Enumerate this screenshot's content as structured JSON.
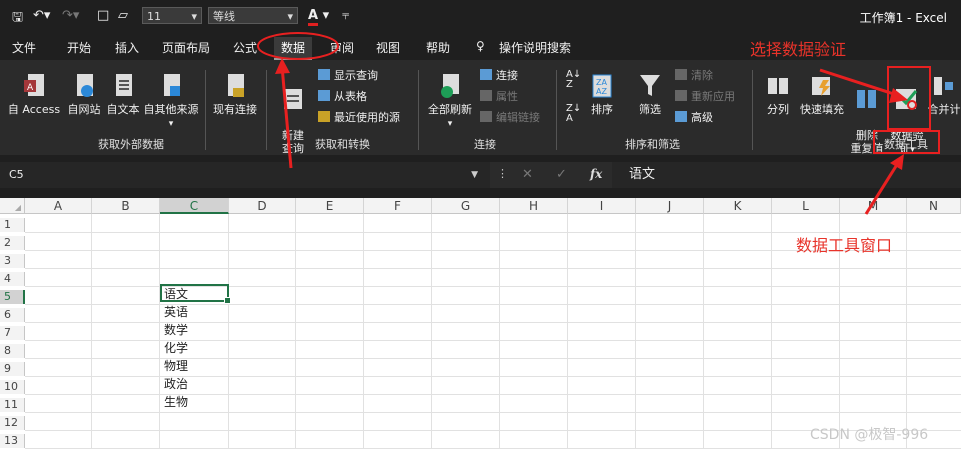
{
  "qat": {
    "font_size": "11",
    "font_name": "等线",
    "font_color_btn": "A",
    "title": "工作簿1 - Excel"
  },
  "menu": [
    {
      "label": "文件"
    },
    {
      "label": "开始"
    },
    {
      "label": "插入"
    },
    {
      "label": "页面布局"
    },
    {
      "label": "公式"
    },
    {
      "label": "数据"
    },
    {
      "label": "审阅"
    },
    {
      "label": "视图"
    },
    {
      "label": "帮助"
    },
    {
      "label": "操作说明搜索"
    }
  ],
  "ribbon": {
    "get_external": {
      "access": "自 Access",
      "web": "自网站",
      "text": "自文本",
      "other": "自其他来源",
      "existing": "现有连接",
      "group": "获取外部数据"
    },
    "transform": {
      "new_query": "新建\n查询",
      "show_queries": "显示查询",
      "from_table": "从表格",
      "recent_sources": "最近使用的源",
      "group": "获取和转换"
    },
    "connections": {
      "refresh_all": "全部刷新",
      "connections": "连接",
      "properties": "属性",
      "edit_links": "编辑链接",
      "group": "连接"
    },
    "sort_filter": {
      "sort": "排序",
      "filter": "筛选",
      "clear": "清除",
      "reapply": "重新应用",
      "advanced": "高级",
      "group": "排序和筛选"
    },
    "data_tools": {
      "text_to_columns": "分列",
      "flash_fill": "快速填充",
      "remove_dup": "删除\n重复值",
      "validation": "数据验\n证",
      "consolidate": "合并计",
      "group": "数据工具"
    }
  },
  "formula_bar": {
    "name_box": "C5",
    "fx": "fx",
    "value": "语文"
  },
  "grid": {
    "columns": [
      "A",
      "B",
      "C",
      "D",
      "E",
      "F",
      "G",
      "H",
      "I",
      "J",
      "K",
      "L",
      "M",
      "N"
    ],
    "rows": [
      "1",
      "2",
      "3",
      "4",
      "5",
      "6",
      "7",
      "8",
      "9",
      "10",
      "11",
      "12",
      "13"
    ],
    "selected_col": "C",
    "selected_row": "5",
    "cells_c": [
      "语文",
      "英语",
      "数学",
      "化学",
      "物理",
      "政治",
      "生物"
    ]
  },
  "annotations": {
    "select_validation": "选择数据验证",
    "data_tools_window": "数据工具窗口"
  },
  "watermark": "CSDN @极智-996",
  "colors": {
    "accent": "#217346",
    "annotation": "#e82020",
    "ribbon_bg": "#2b2b2b"
  }
}
